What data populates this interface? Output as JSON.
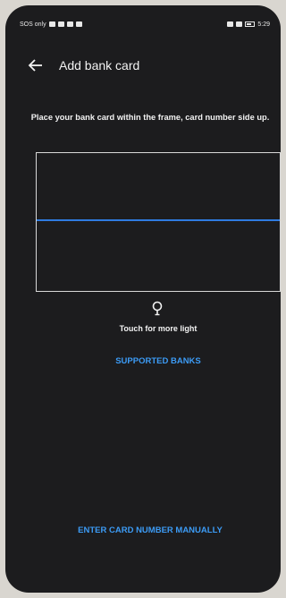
{
  "status_bar": {
    "left_text": "SOS only",
    "time": "5:29"
  },
  "appbar": {
    "back_icon": "arrow-left-icon",
    "title": "Add bank card"
  },
  "scanner": {
    "instruction": "Place your bank card within the frame, card number side up.",
    "scan_line_color": "#2f7be0",
    "light_icon": "bulb-icon",
    "light_label": "Touch for more light"
  },
  "links": {
    "supported_banks": "SUPPORTED BANKS",
    "enter_manually": "ENTER CARD NUMBER MANUALLY",
    "accent_color": "#3c9bf5"
  }
}
